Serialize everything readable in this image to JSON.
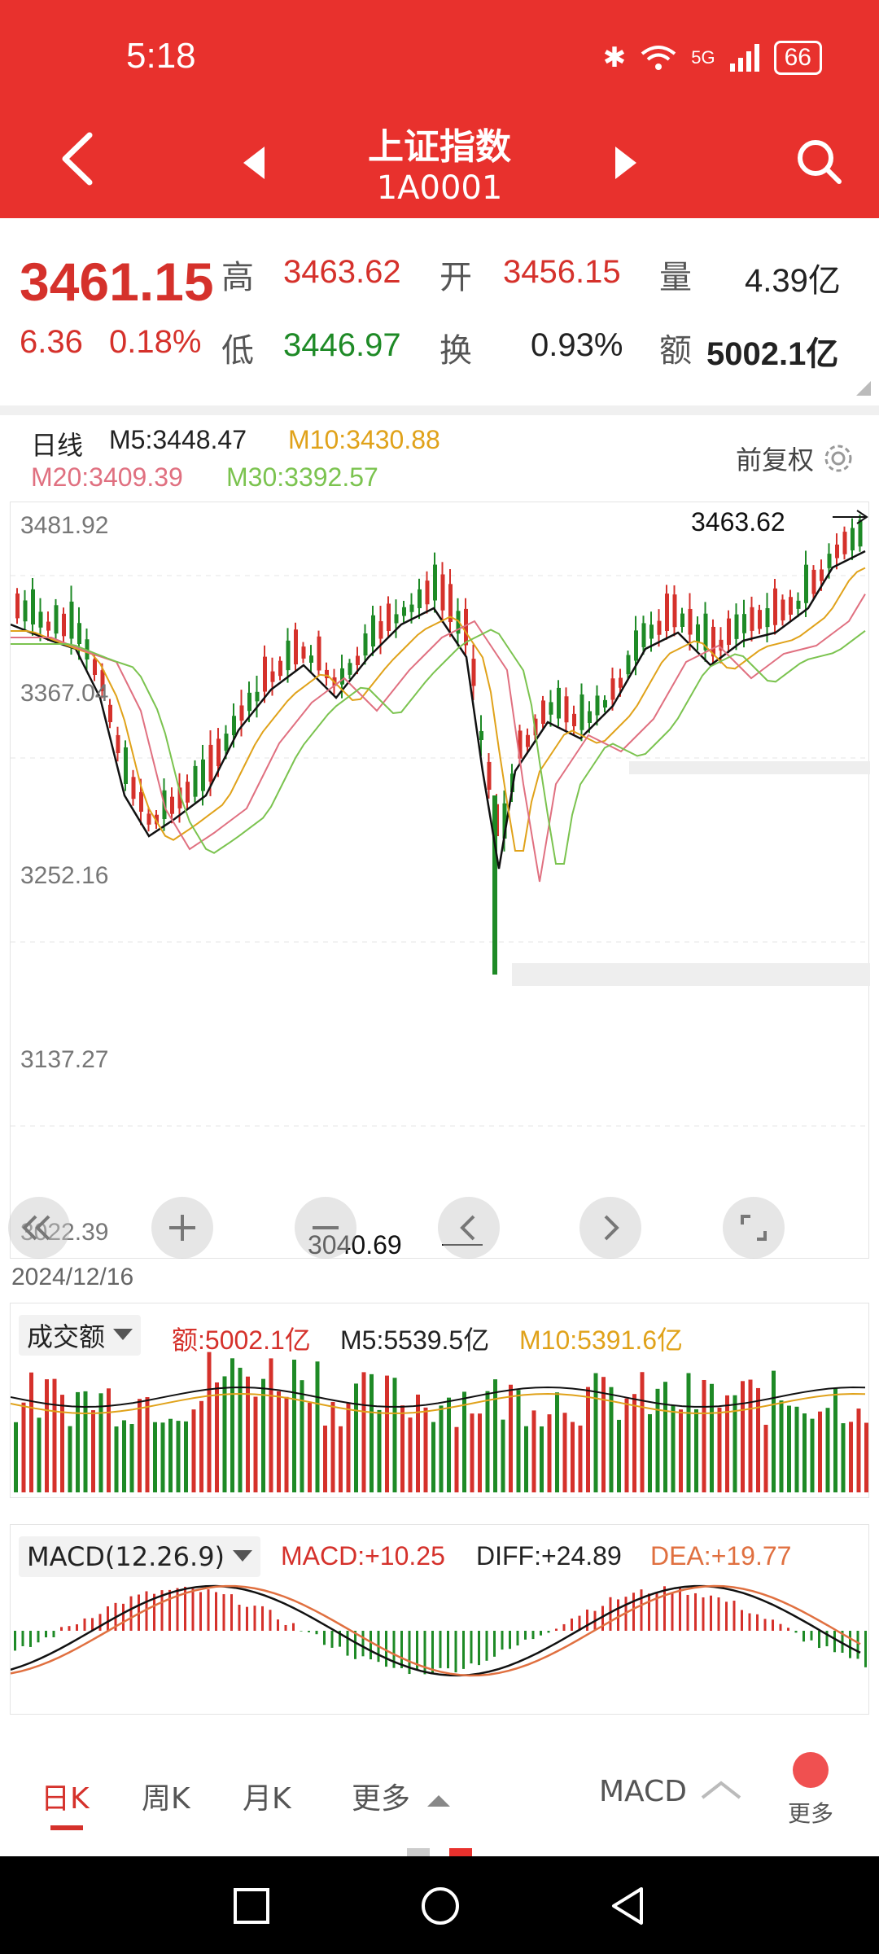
{
  "status": {
    "time": "5:18",
    "battery": "66",
    "signal": "5G"
  },
  "nav": {
    "title": "上证指数",
    "code": "1A0001"
  },
  "quote": {
    "price": "3461.15",
    "change": "6.36",
    "change_pct": "0.18%",
    "high_label": "高",
    "high": "3463.62",
    "low_label": "低",
    "low": "3446.97",
    "open_label": "开",
    "open": "3456.15",
    "turnover_label": "换",
    "turnover": "0.93%",
    "volume_label": "量",
    "volume": "4.39亿",
    "amount_label": "额",
    "amount": "5002.1亿"
  },
  "kline_header": {
    "period": "日线",
    "m5": "M5:3448.47",
    "m10": "M10:3430.88",
    "m20": "M20:3409.39",
    "m30": "M30:3392.57",
    "adjust": "前复权"
  },
  "colors": {
    "red": "#d5312b",
    "green": "#1e8a26",
    "ma5": "#111111",
    "ma10": "#e0a21a",
    "ma20": "#e07080",
    "ma30": "#7bc34f",
    "brand": "#e8312d"
  },
  "chart_data": {
    "type": "candlestick",
    "y_ticks": [
      "3481.92",
      "3367.04",
      "3252.16",
      "3137.27",
      "3022.39"
    ],
    "ylim": [
      3022.39,
      3481.92
    ],
    "high_marker": "3463.62",
    "low_marker": "3040.69",
    "date": "2024/12/16"
  },
  "volume": {
    "selector": "成交额",
    "value": "额:5002.1亿",
    "m5": "M5:5539.5亿",
    "m10": "M10:5391.6亿"
  },
  "macd": {
    "selector": "MACD(12.26.9)",
    "macd": "MACD:+10.25",
    "diff": "DIFF:+24.89",
    "dea": "DEA:+19.77"
  },
  "tabs": {
    "day": "日K",
    "week": "周K",
    "month": "月K",
    "more": "更多",
    "indicator": "MACD",
    "more_btn": "更多"
  }
}
